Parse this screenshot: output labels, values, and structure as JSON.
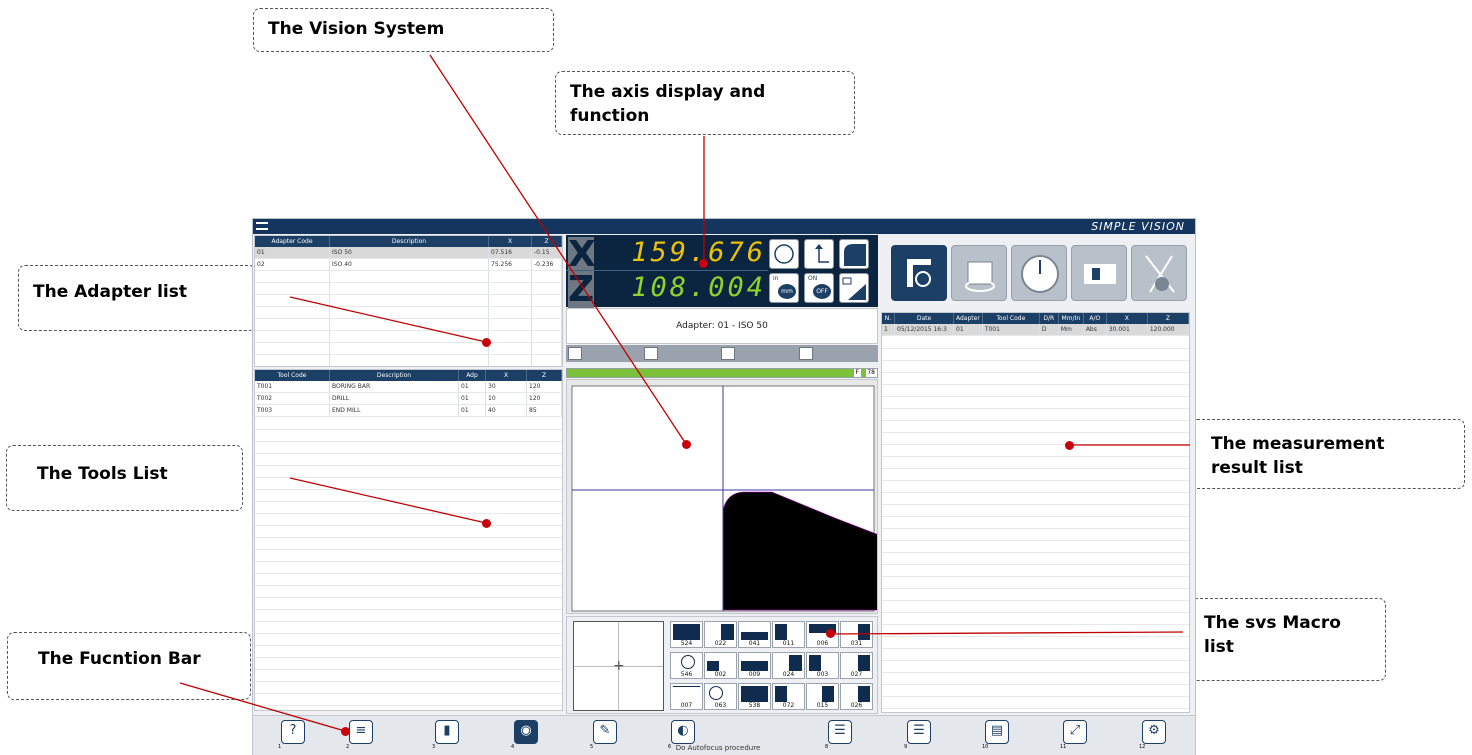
{
  "callouts": {
    "vision": "The Vision System",
    "axis_line1": "The axis display and",
    "axis_line2": "function",
    "adapter": "The Adapter list",
    "tools": "The Tools List",
    "measurement_line1": "The measurement",
    "measurement_line2": "result list",
    "macro_line1": "The svs Macro",
    "macro_line2": "list",
    "function_bar": "The Fucntion Bar"
  },
  "app": {
    "brand": "SIMPLE VISION",
    "adapter_table": {
      "headers": [
        "Adapter Code",
        "Description",
        "X",
        "Z"
      ],
      "rows": [
        [
          "01",
          "ISO 50",
          "07.516",
          "-0.15"
        ],
        [
          "02",
          "ISO 40",
          "75.256",
          "-0.236"
        ]
      ]
    },
    "tool_table": {
      "headers": [
        "Tool Code",
        "Description",
        "Adp",
        "X",
        "Z"
      ],
      "rows": [
        [
          "T001",
          "BORING BAR",
          "01",
          "30",
          "120"
        ],
        [
          "T002",
          "DRILL",
          "01",
          "10",
          "120"
        ],
        [
          "T003",
          "END MILL",
          "01",
          "40",
          "85"
        ]
      ]
    },
    "dro": {
      "x_label": "X",
      "x_value": "159.676",
      "z_label": "Z",
      "z_value": "108.004",
      "unit_top": "in",
      "unit_btn": "mm",
      "on_top": "ON",
      "off_btn": "OFF"
    },
    "adapter_info": "Adapter: 01 - ISO 50",
    "focus": {
      "mode": "F",
      "value": "78",
      "level": 0.97
    },
    "measure_table": {
      "headers": [
        "N.",
        "Date",
        "Adapter",
        "Tool Code",
        "D/R",
        "Mm/In",
        "A/O",
        "X",
        "Z"
      ],
      "rows": [
        [
          "1",
          "05/12/2015 16:3",
          "01",
          "T001",
          "D",
          "Mm",
          "Abs",
          "30.001",
          "120.000"
        ]
      ]
    },
    "macros": [
      "524",
      "022",
      "041",
      "011",
      "006",
      "031",
      "546",
      "002",
      "009",
      "024",
      "003",
      "027",
      "007",
      "063",
      "538",
      "072",
      "015",
      "026"
    ],
    "function_keys": [
      "1",
      "2",
      "3",
      "4",
      "5",
      "6",
      "8",
      "9",
      "10",
      "11",
      "12"
    ],
    "status": "Do Autofocus procedure"
  }
}
